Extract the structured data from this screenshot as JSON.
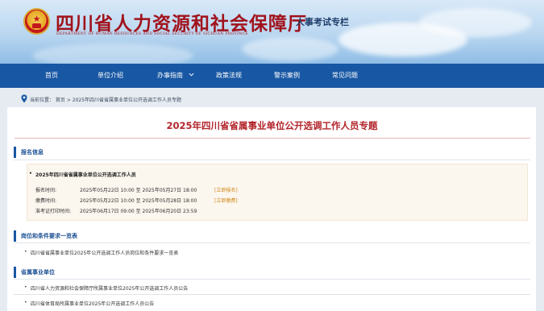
{
  "header": {
    "title": "四川省人力资源和社会保障厅",
    "subtitle": "DEPARTMENT OF HUMAN RESOURCES AND SOCIAL SECURITY OF SICHUAN PROVINCE",
    "tag": "人事考试专栏",
    "emblem_icon": "national-emblem-icon"
  },
  "nav": {
    "items": [
      "首页",
      "单位介绍",
      "办事指南",
      "政策法规",
      "警示案例",
      "常见问题"
    ]
  },
  "breadcrumb": {
    "text": "当前位置： 首页 > 2025年四川省省属事业单位公开选调工作人员专题"
  },
  "page": {
    "title": "2025年四川省省属事业单位公开选调工作人员专题"
  },
  "signup": {
    "heading": "报名信息",
    "item_title": "2025年四川省省属事业单位公开选调工作人员",
    "rows": [
      {
        "label": "报名时间:",
        "value": "2025年05月22日 10:00 至 2025年05月27日 18:00",
        "link": "[立即报名]"
      },
      {
        "label": "缴费时间:",
        "value": "2025年05月22日 10:00 至 2025年05月28日 18:00",
        "link": "[立即缴费]"
      },
      {
        "label": "准考证打印时间:",
        "value": "2025年06月17日 09:00 至 2025年06月20日 23:59",
        "link": ""
      }
    ]
  },
  "positions": {
    "heading": "岗位和条件要求一览表",
    "items": [
      "四川省省属事业单位2025年公开选调工作人员岗位和条件要求一览表"
    ]
  },
  "units": {
    "heading": "省属事业单位",
    "items": [
      "四川省人力资源和社会保障厅所属事业单位2025年公开选调工作人员公告",
      "四川省体育局所属事业单位2025年公开选调工作人员公告"
    ]
  },
  "colors": {
    "brand_red": "#a1121b",
    "nav_blue": "#1857a3",
    "title_red": "#b2242a",
    "link_orange": "#d28a1c"
  }
}
